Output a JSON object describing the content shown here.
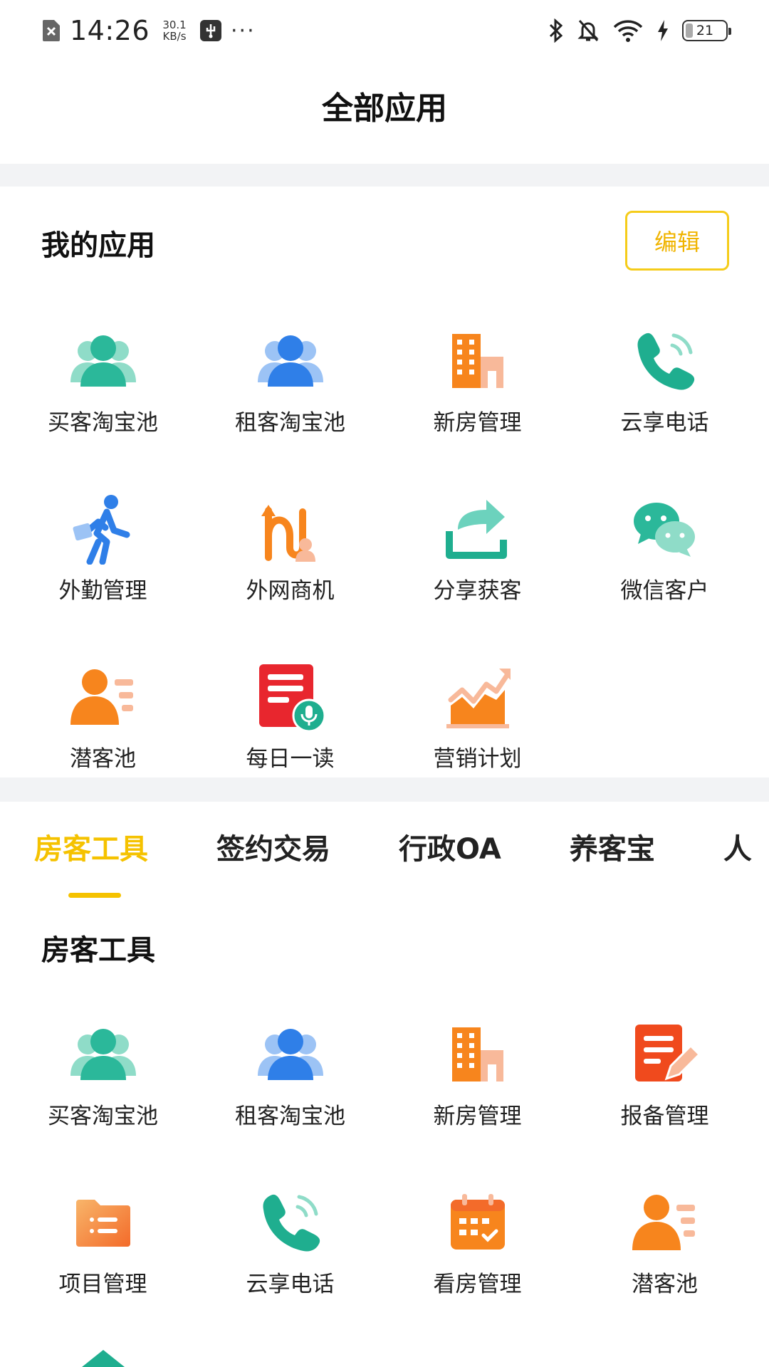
{
  "status_bar": {
    "time": "14:26",
    "speed_value": "30.1",
    "speed_unit": "KB/s",
    "more": "···",
    "battery": "21"
  },
  "header": {
    "title": "全部应用"
  },
  "my_apps": {
    "title": "我的应用",
    "edit_label": "编辑",
    "items": [
      {
        "label": "买客淘宝池",
        "icon": "people-teal-icon"
      },
      {
        "label": "租客淘宝池",
        "icon": "people-blue-icon"
      },
      {
        "label": "新房管理",
        "icon": "building-orange-icon"
      },
      {
        "label": "云享电话",
        "icon": "phone-teal-icon"
      },
      {
        "label": "外勤管理",
        "icon": "walking-person-icon"
      },
      {
        "label": "外网商机",
        "icon": "route-icon"
      },
      {
        "label": "分享获客",
        "icon": "share-icon"
      },
      {
        "label": "微信客户",
        "icon": "wechat-icon"
      },
      {
        "label": "潜客池",
        "icon": "person-list-icon"
      },
      {
        "label": "每日一读",
        "icon": "daily-read-icon"
      },
      {
        "label": "营销计划",
        "icon": "growth-chart-icon"
      }
    ]
  },
  "tabs": [
    {
      "label": "房客工具",
      "active": true
    },
    {
      "label": "签约交易",
      "active": false
    },
    {
      "label": "行政OA",
      "active": false
    },
    {
      "label": "养客宝",
      "active": false
    },
    {
      "label": "人",
      "active": false
    }
  ],
  "tools": {
    "title": "房客工具",
    "items": [
      {
        "label": "买客淘宝池",
        "icon": "people-teal-icon"
      },
      {
        "label": "租客淘宝池",
        "icon": "people-blue-icon"
      },
      {
        "label": "新房管理",
        "icon": "building-orange-icon"
      },
      {
        "label": "报备管理",
        "icon": "report-edit-icon"
      },
      {
        "label": "项目管理",
        "icon": "folder-list-icon"
      },
      {
        "label": "云享电话",
        "icon": "phone-teal-icon"
      },
      {
        "label": "看房管理",
        "icon": "calendar-icon"
      },
      {
        "label": "潜客池",
        "icon": "person-list-icon"
      }
    ]
  },
  "colors": {
    "accent": "#f5c200",
    "teal": "#2bb89a",
    "blue": "#2f7fe8",
    "orange": "#f7851d",
    "red": "#e8262e"
  }
}
